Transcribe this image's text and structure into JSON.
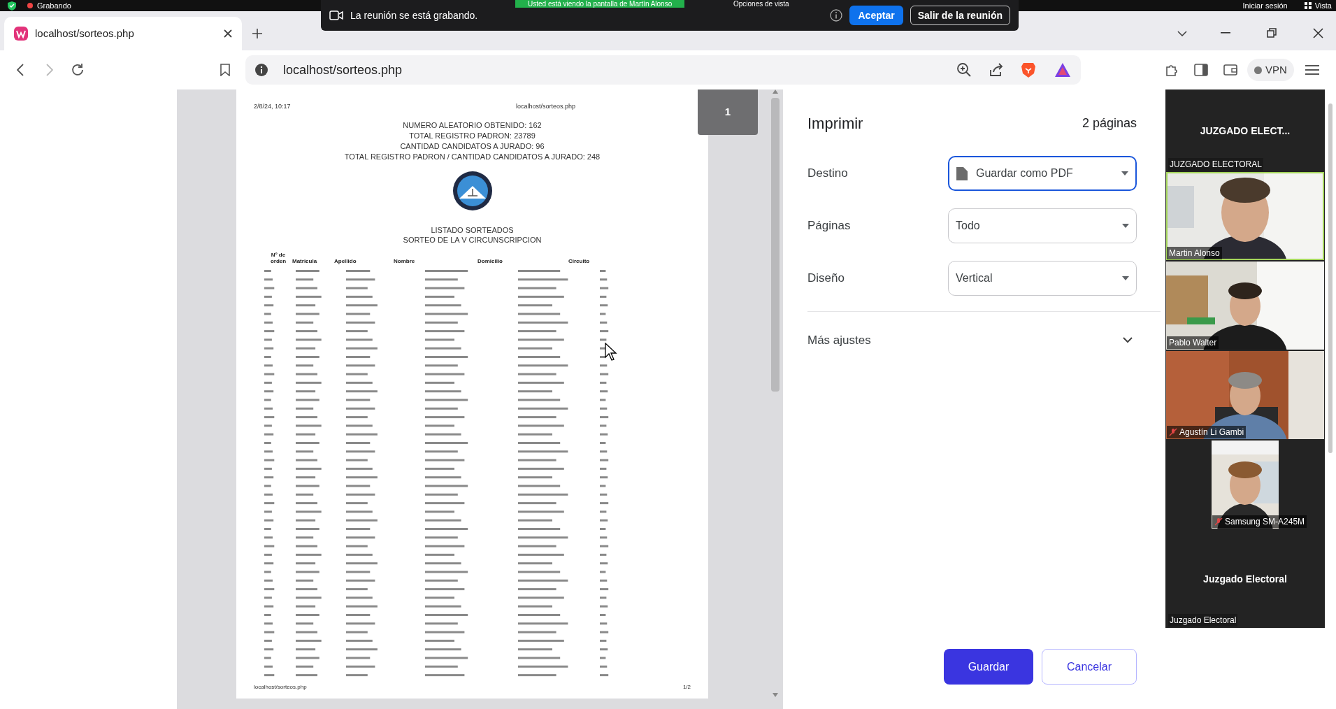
{
  "system_bar": {
    "recording": "Grabando",
    "sign_in": "Iniciar sesión",
    "view": "Vista"
  },
  "meeting_notice": {
    "message": "La reunión se está grabando.",
    "sharing_banner": "Usted está viendo la pantalla de Martín Alonso",
    "view_options": "Opciones de vista",
    "accept": "Aceptar",
    "leave": "Salir de la reunión"
  },
  "browser": {
    "tab_title": "localhost/sorteos.php",
    "url": "localhost/sorteos.php",
    "vpn": "VPN"
  },
  "preview": {
    "page_badge": "1",
    "date": "2/8/24, 10:17",
    "header_url": "localhost/sorteos.php",
    "summary": [
      "NUMERO ALEATORIO OBTENIDO: 162",
      "TOTAL REGISTRO PADRON: 23789",
      "CANTIDAD CANDIDATOS A JURADO: 96",
      "TOTAL REGISTRO PADRON / CANTIDAD CANDIDATOS A JURADO: 248"
    ],
    "list_title": "LISTADO SORTEADOS",
    "list_subtitle": "SORTEO DE LA V CIRCUNSCRIPCION",
    "columns": [
      "Nº de orden",
      "Matricula",
      "Apellido",
      "Nombre",
      "Domicilio",
      "Circuito"
    ],
    "footer_url": "localhost/sorteos.php",
    "footer_page": "1/2"
  },
  "print_panel": {
    "title": "Imprimir",
    "page_count": "2 páginas",
    "settings": [
      {
        "label": "Destino",
        "value": "Guardar como PDF",
        "focused": true,
        "kind": "file"
      },
      {
        "label": "Páginas",
        "value": "Todo",
        "focused": false,
        "kind": "plain"
      },
      {
        "label": "Diseño",
        "value": "Vertical",
        "focused": false,
        "kind": "plain"
      }
    ],
    "more": "Más ajustes",
    "save": "Guardar",
    "cancel": "Cancelar"
  },
  "participants": {
    "header": "JUZGADO ELECT...",
    "header_label": "JUZGADO ELECTORAL",
    "videos": [
      {
        "name": "Martin Alonso",
        "muted": false,
        "speaking": true,
        "wide": true
      },
      {
        "name": "Pablo Walter",
        "muted": false,
        "speaking": false,
        "wide": true
      },
      {
        "name": "Agustín Li Gambi",
        "muted": true,
        "speaking": false,
        "wide": true
      },
      {
        "name": "Samsung SM-A245M",
        "muted": true,
        "speaking": false,
        "wide": false
      }
    ],
    "footer_title": "Juzgado Electoral",
    "footer_label": "Juzgado Electoral"
  }
}
